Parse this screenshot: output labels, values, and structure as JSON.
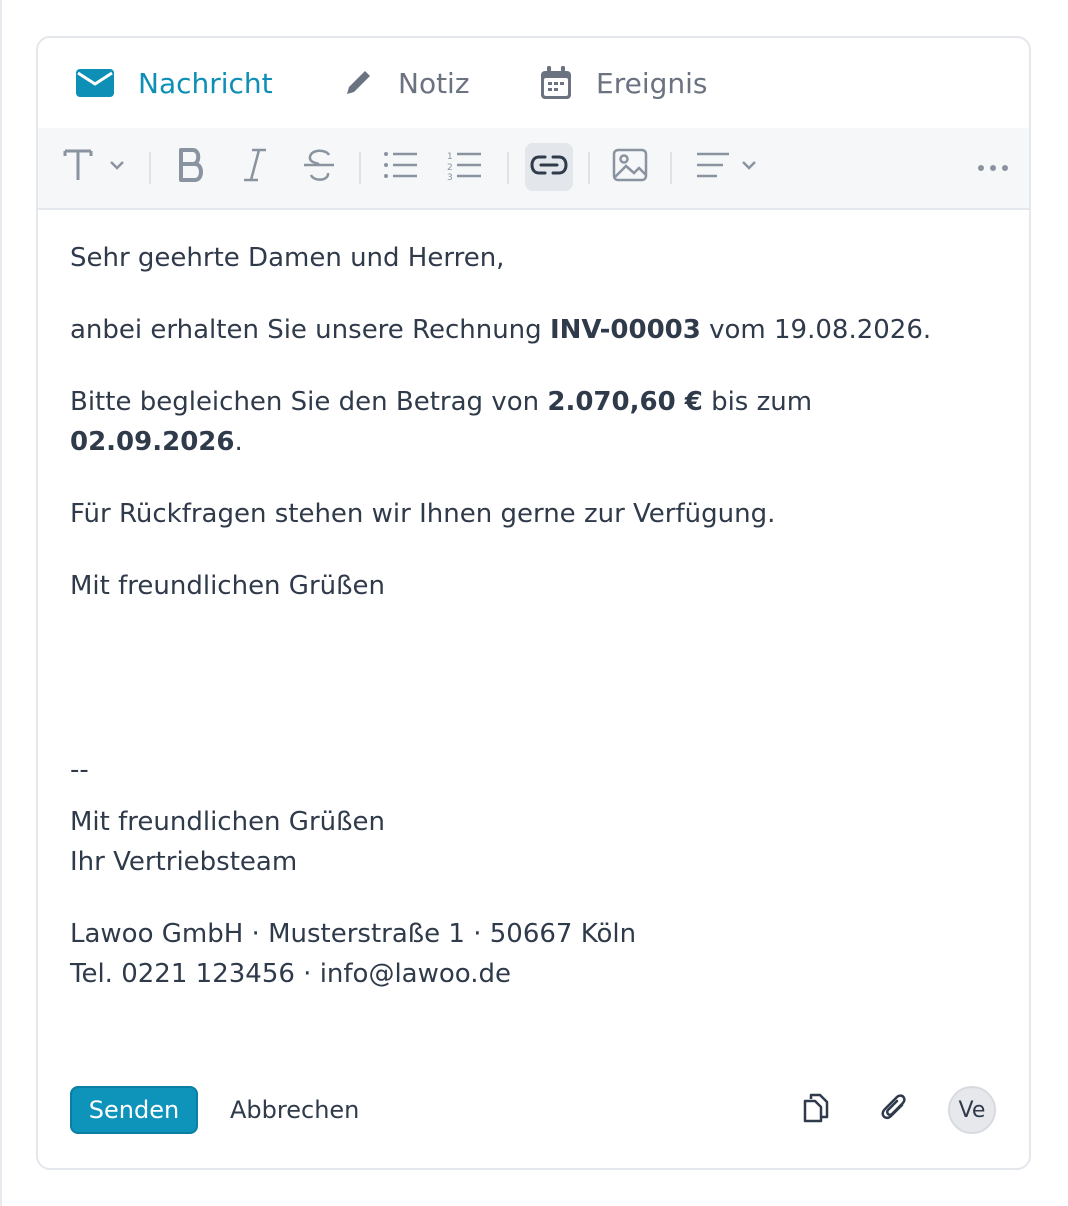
{
  "tabs": [
    {
      "label": "Nachricht",
      "icon": "envelope-icon",
      "active": true
    },
    {
      "label": "Notiz",
      "icon": "pencil-icon",
      "active": false
    },
    {
      "label": "Ereignis",
      "icon": "calendar-icon",
      "active": false
    }
  ],
  "toolbar": {
    "items": [
      "text-style",
      "bold",
      "italic",
      "strikethrough",
      "bullet-list",
      "numbered-list",
      "link",
      "image",
      "align",
      "more"
    ],
    "active_item": "link"
  },
  "message": {
    "greeting": "Sehr geehrte Damen und Herren,",
    "line2_pre": "anbei erhalten Sie unsere Rechnung ",
    "invoice_number": "INV-00003",
    "line2_post": " vom 19.08.2026.",
    "line3_pre": "Bitte begleichen Sie den Betrag von ",
    "amount": "2.070,60 €",
    "line3_mid": " bis zum ",
    "due_date": "02.09.2026",
    "line3_post": ".",
    "line4": "Für Rückfragen stehen wir Ihnen gerne zur Verfügung.",
    "closing": "Mit freundlichen Grüßen"
  },
  "signature": {
    "separator": "--",
    "closing": "Mit freundlichen Grüßen",
    "team": "Ihr Vertriebsteam",
    "address": "Lawoo GmbH · Musterstraße 1 · 50667 Köln",
    "contact": "Tel. 0221 123456 · info@lawoo.de"
  },
  "footer": {
    "send_label": "Senden",
    "cancel_label": "Abbrechen",
    "avatar_initials": "Ve"
  },
  "colors": {
    "accent": "#0e93bb",
    "text": "#2f3a4a",
    "muted": "#6b7280"
  }
}
